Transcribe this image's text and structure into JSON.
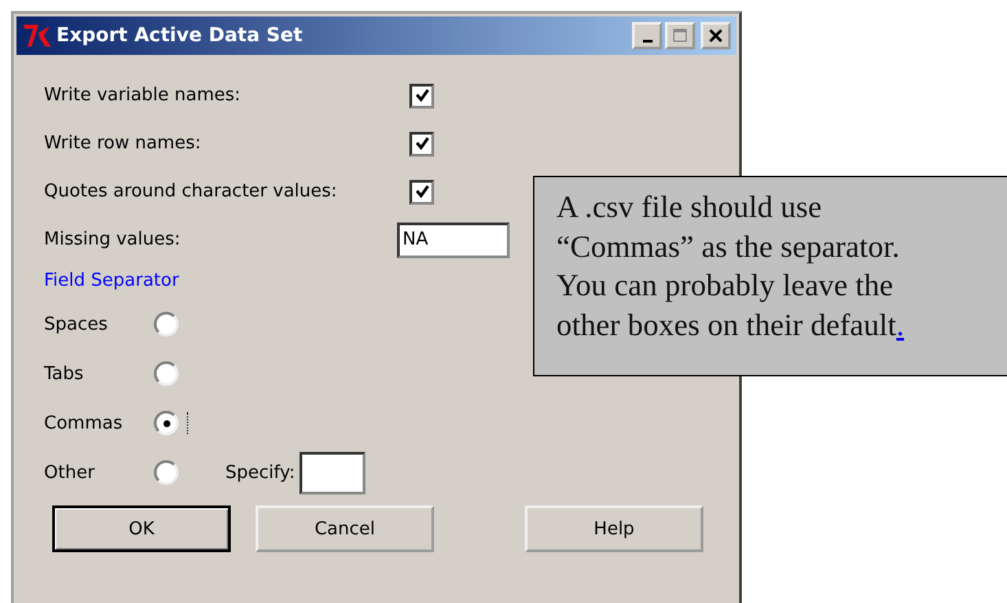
{
  "window": {
    "title": "Export Active Data Set"
  },
  "checkboxes": [
    {
      "label": "Write variable names:",
      "checked": true
    },
    {
      "label": "Write row names:",
      "checked": true
    },
    {
      "label": "Quotes around character values:",
      "checked": true
    }
  ],
  "missing_values": {
    "label": "Missing values:",
    "value": "NA"
  },
  "field_separator": {
    "heading": "Field Separator",
    "options": [
      {
        "label": "Spaces",
        "selected": false
      },
      {
        "label": "Tabs",
        "selected": false
      },
      {
        "label": "Commas",
        "selected": true
      },
      {
        "label": "Other",
        "selected": false
      }
    ],
    "specify_label": "Specify:"
  },
  "buttons": [
    {
      "label": "OK",
      "default": true
    },
    {
      "label": "Cancel",
      "default": false
    },
    {
      "label": "Help",
      "default": false
    }
  ],
  "callout": {
    "text": "A .csv file should use “Commas” as the separator. You can probably leave the other boxes on their default",
    "link_text": "."
  }
}
